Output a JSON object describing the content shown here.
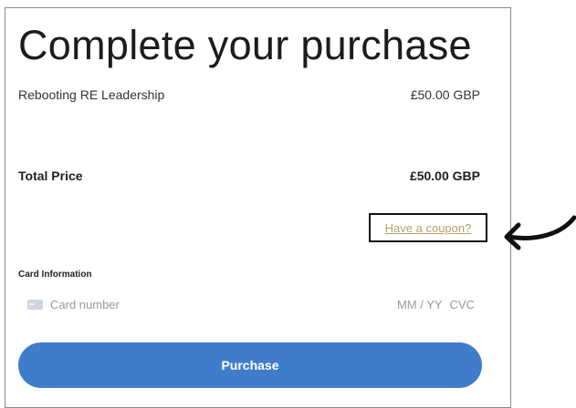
{
  "checkout": {
    "title": "Complete your purchase",
    "item": {
      "name": "Rebooting RE Leadership",
      "price": "£50.00 GBP"
    },
    "total": {
      "label": "Total Price",
      "price": "£50.00 GBP"
    },
    "coupon_link": "Have a coupon?",
    "card": {
      "label": "Card Information",
      "number_placeholder": "Card number",
      "expiry_placeholder": "MM / YY",
      "cvc_placeholder": "CVC"
    },
    "purchase_button": "Purchase"
  },
  "colors": {
    "button": "#3f7dcb",
    "coupon_link": "#b2a36b",
    "annotation": "#111111"
  },
  "icons": [
    "credit-card-icon",
    "curved-arrow-annotation"
  ]
}
